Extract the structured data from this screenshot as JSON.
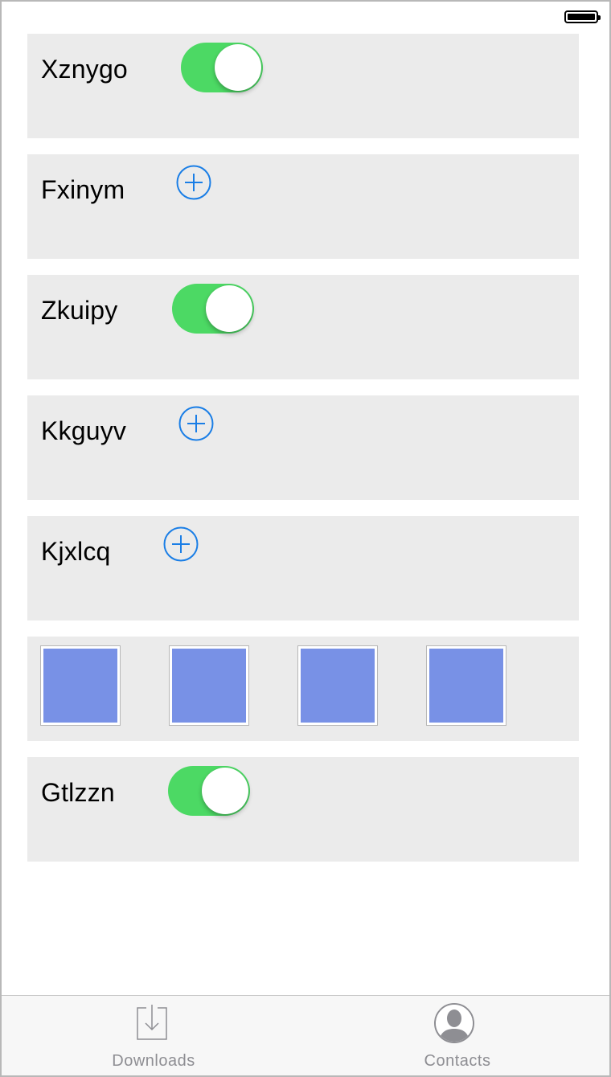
{
  "status_bar": {
    "battery_icon": "battery-full-icon"
  },
  "rows": [
    {
      "type": "toggle",
      "label": "Xznygo",
      "on": true
    },
    {
      "type": "add",
      "label": "Fxinym",
      "icon": "add-circle-icon"
    },
    {
      "type": "toggle",
      "label": "Zkuipy",
      "on": true
    },
    {
      "type": "add",
      "label": "Kkguyv",
      "icon": "add-circle-icon"
    },
    {
      "type": "add",
      "label": "Kjxlcq",
      "icon": "add-circle-icon"
    },
    {
      "type": "thumbnails",
      "count": 4
    },
    {
      "type": "toggle",
      "label": "Gtlzzn",
      "on": true
    }
  ],
  "tab_bar": {
    "tabs": [
      {
        "label": "Downloads",
        "icon": "download-tray-icon"
      },
      {
        "label": "Contacts",
        "icon": "contact-avatar-icon"
      }
    ]
  },
  "colors": {
    "toggle_on": "#4cd964",
    "add_icon": "#1a7ee6",
    "thumbnail_fill": "#7891e6",
    "row_bg": "#ebebeb",
    "tab_inactive": "#8e8e93"
  }
}
